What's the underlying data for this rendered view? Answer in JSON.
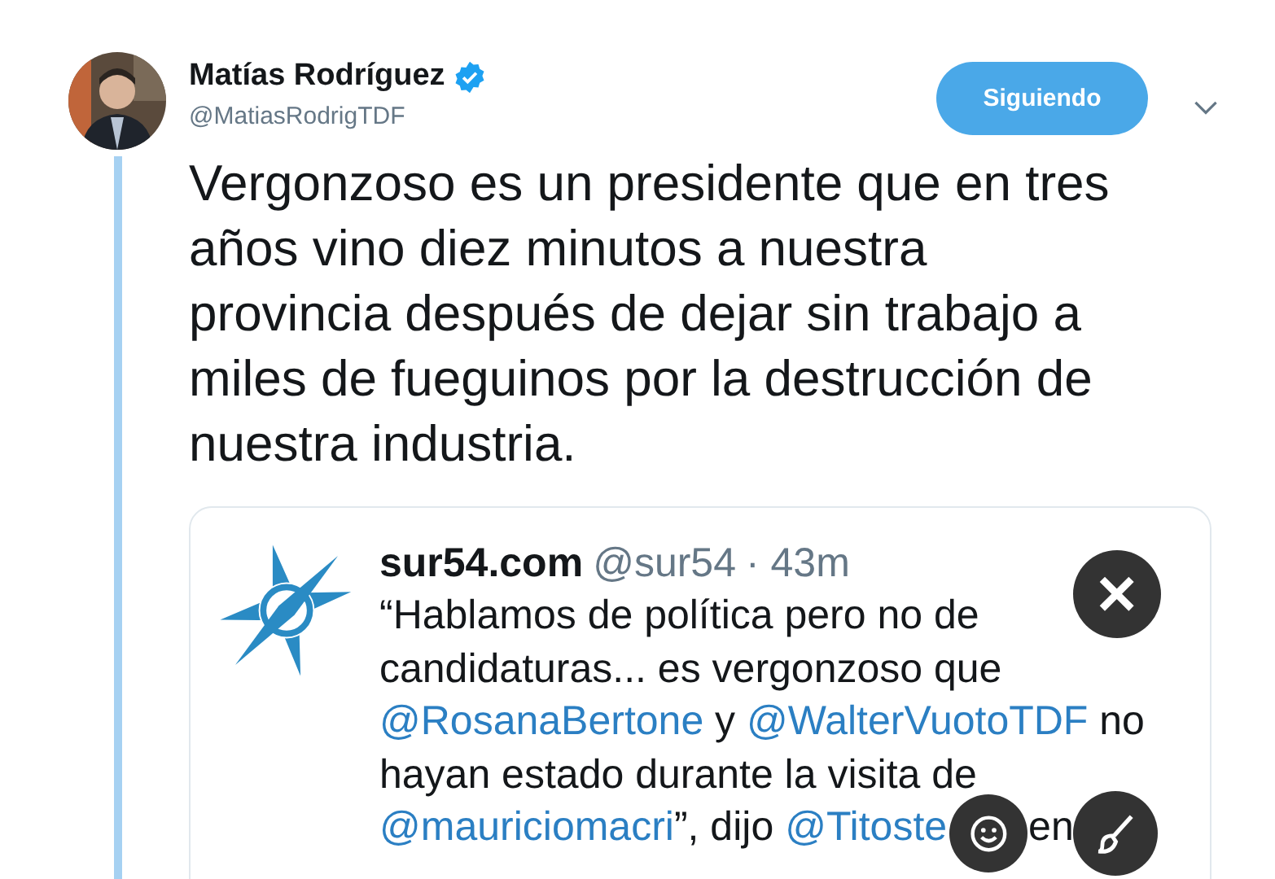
{
  "author": {
    "name": "Matías Rodríguez",
    "verified": true,
    "handle": "@MatiasRodrigTDF"
  },
  "follow_button": {
    "label": "Siguiendo",
    "selected": true
  },
  "tweet_lines": [
    "Vergonzoso es un presidente que en tres",
    "años vino diez minutos a nuestra",
    "provincia después de dejar sin trabajo a",
    "miles de fueguinos por la destrucción de",
    "nuestra industria."
  ],
  "quote": {
    "name": "sur54.com",
    "handle": "@sur54",
    "time": "· 43m",
    "lines": [
      [
        {
          "text": "“Hablamos de política pero no de",
          "link": false
        }
      ],
      [
        {
          "text": "candidaturas... es vergonzoso que",
          "link": false
        }
      ],
      [
        {
          "text": "@RosanaBertone",
          "link": true
        },
        {
          "text": " y ",
          "link": false
        },
        {
          "text": "@WalterVuotoTDF",
          "link": true
        },
        {
          "text": " no",
          "link": false
        }
      ],
      [
        {
          "text": "hayan estado durante la visita de",
          "link": false
        }
      ],
      [
        {
          "text": "@mauriciomacri",
          "link": true
        },
        {
          "text": "”, dijo ",
          "link": false
        },
        {
          "text": "@Titoste",
          "link": true
        },
        {
          "text": "en",
          "link": false
        }
      ]
    ]
  }
}
